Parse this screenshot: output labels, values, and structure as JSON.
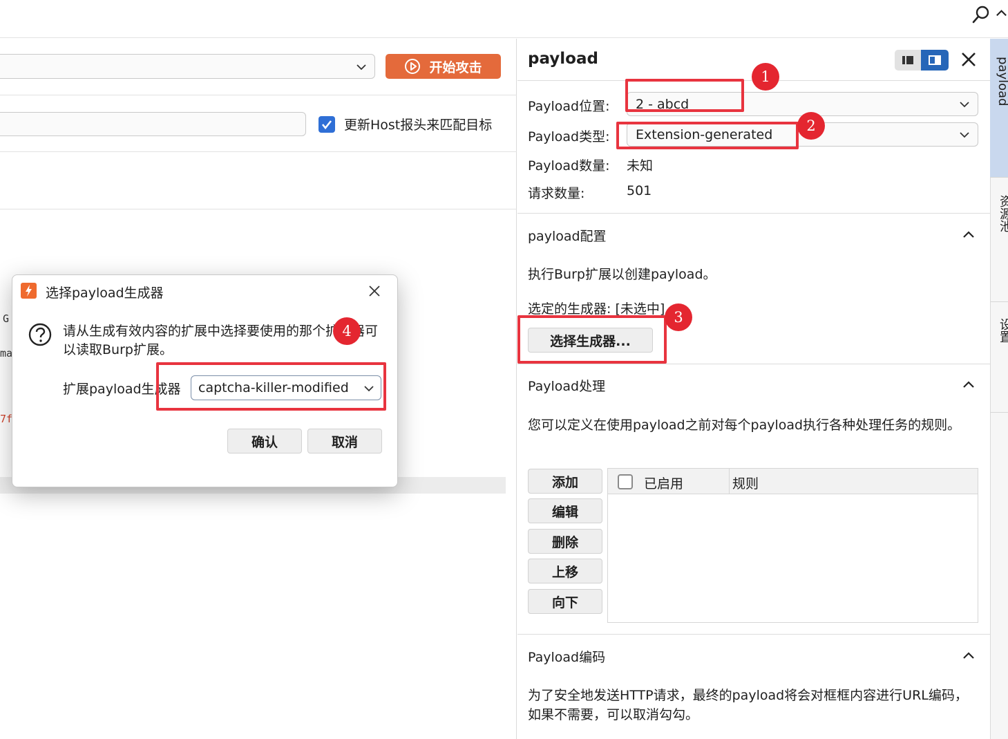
{
  "header": {
    "icons": [
      "search-icon",
      "collapse-icon"
    ]
  },
  "left": {
    "attack_button_label": "开始攻击",
    "host_checkbox_checked": true,
    "host_checkbox_label": "更新Host报头来匹配目标",
    "edge_fragments": [
      "G",
      "ma",
      "7f"
    ]
  },
  "panel": {
    "title": "payload",
    "position_label": "Payload位置:",
    "position_value": "2 - abcd",
    "type_label": "Payload类型:",
    "type_value": "Extension-generated",
    "count_label": "Payload数量:",
    "count_value": "未知",
    "requests_label": "请求数量:",
    "requests_value": "501",
    "config": {
      "title": "payload配置",
      "description": "执行Burp扩展以创建payload。",
      "selected_generator": "选定的生成器: [未选中]",
      "choose_button": "选择生成器..."
    },
    "processing": {
      "title": "Payload处理",
      "description": "您可以定义在使用payload之前对每个payload执行各种处理任务的规则。",
      "buttons": [
        "添加",
        "编辑",
        "删除",
        "上移",
        "向下"
      ],
      "columns": [
        "已启用",
        "规则"
      ]
    },
    "encoding": {
      "title": "Payload编码",
      "description": "为了安全地发送HTTP请求，最终的payload将会对框框内容进行URL编码，如果不需要，可以取消勾勾。"
    }
  },
  "side_rail": {
    "tabs": [
      "payload",
      "资源池",
      "设置"
    ]
  },
  "dialog": {
    "title": "选择payload生成器",
    "message": "请从生成有效内容的扩展中选择要使用的那个扩展器可以读取Burp扩展。",
    "generator_label": "扩展payload生成器",
    "generator_value": "captcha-killer-modified",
    "ok_label": "确认",
    "cancel_label": "取消"
  },
  "annotations": {
    "color": "#e42630",
    "numbers": [
      "1",
      "2",
      "3",
      "4"
    ]
  },
  "colors": {
    "accent_orange": "#e46a3b",
    "accent_blue": "#2666b8",
    "rail_active": "#c9d8ee"
  }
}
